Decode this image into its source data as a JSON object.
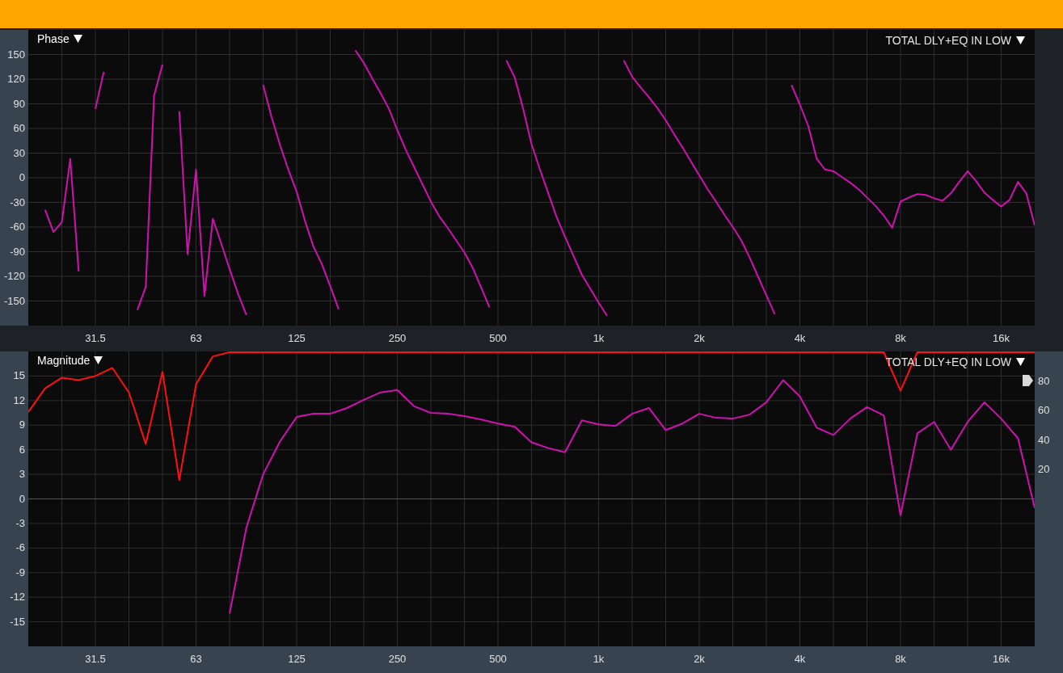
{
  "phase_panel": {
    "title": "Phase",
    "trace_label": "TOTAL DLY+EQ IN LOW",
    "chart_data": {
      "type": "line",
      "grid": true,
      "ylim": [
        -180,
        180
      ],
      "yticks": [
        150,
        120,
        90,
        60,
        30,
        0,
        -30,
        -60,
        -90,
        -120,
        -150
      ],
      "categories": [
        null,
        null,
        null,
        null,
        null,
        null,
        null,
        null,
        "31.5",
        null,
        null,
        null,
        null,
        null,
        null,
        null,
        null,
        null,
        null,
        null,
        "63",
        null,
        null,
        null,
        null,
        null,
        null,
        null,
        null,
        null,
        null,
        null,
        "125",
        null,
        null,
        null,
        null,
        null,
        null,
        null,
        null,
        null,
        null,
        null,
        "250",
        null,
        null,
        null,
        null,
        null,
        null,
        null,
        null,
        null,
        null,
        null,
        "500",
        null,
        null,
        null,
        null,
        null,
        null,
        null,
        null,
        null,
        null,
        null,
        "1k",
        null,
        null,
        null,
        null,
        null,
        null,
        null,
        null,
        null,
        null,
        null,
        "2k",
        null,
        null,
        null,
        null,
        null,
        null,
        null,
        null,
        null,
        null,
        null,
        "4k",
        null,
        null,
        null,
        null,
        null,
        null,
        null,
        null,
        null,
        null,
        null,
        "8k",
        null,
        null,
        null,
        null,
        null,
        null,
        null,
        null,
        null,
        null,
        null,
        "16k",
        null,
        null,
        null,
        null
      ],
      "series": [
        {
          "color": "#d010b0",
          "values": [
            null,
            null,
            -39,
            -66,
            -54,
            23,
            -114,
            null,
            84,
            129,
            null,
            null,
            null,
            -161,
            -133,
            100,
            138,
            null,
            81,
            -93,
            10,
            -144,
            -50,
            -80,
            -111,
            -141,
            -167,
            null,
            113,
            74,
            40,
            10,
            -17,
            -53,
            -84,
            -105,
            -132,
            -160,
            null,
            155,
            140,
            121,
            103,
            84,
            58,
            34,
            13,
            -8,
            -29,
            -47,
            -61,
            -76,
            -91,
            -110,
            -134,
            -158,
            null,
            143,
            122,
            84,
            41,
            10,
            -19,
            -48,
            -72,
            -95,
            -118,
            -135,
            -152,
            -168,
            null,
            143,
            123,
            110,
            98,
            85,
            70,
            53,
            37,
            20,
            3,
            -14,
            -29,
            -45,
            -60,
            -76,
            -97,
            -120,
            -143,
            -166,
            null,
            113,
            89,
            63,
            23,
            10,
            8,
            1,
            -6,
            -14,
            -24,
            -34,
            -46,
            -61,
            -29,
            -24,
            -20,
            -21,
            -25,
            -28,
            -19,
            -5,
            8,
            -4,
            -18,
            -27,
            -35,
            -27,
            -5,
            -19,
            -58
          ]
        }
      ]
    }
  },
  "magnitude_panel": {
    "title": "Magnitude",
    "trace_label": "TOTAL DLY+EQ IN LOW",
    "chart_data": {
      "type": "line",
      "grid": true,
      "ylim": [
        -18,
        18
      ],
      "yticks": [
        15,
        12,
        9,
        6,
        3,
        0,
        -3,
        -6,
        -9,
        -12,
        -15
      ],
      "y2lim": [
        -100,
        100
      ],
      "y2ticks": [
        80,
        60,
        40,
        20
      ],
      "categories": [
        null,
        null,
        null,
        null,
        "31.5",
        null,
        null,
        null,
        null,
        null,
        "63",
        null,
        null,
        null,
        null,
        null,
        "125",
        null,
        null,
        null,
        null,
        null,
        "250",
        null,
        null,
        null,
        null,
        null,
        "500",
        null,
        null,
        null,
        null,
        null,
        "1k",
        null,
        null,
        null,
        null,
        null,
        "2k",
        null,
        null,
        null,
        null,
        null,
        "4k",
        null,
        null,
        null,
        null,
        null,
        "8k",
        null,
        null,
        null,
        null,
        null,
        "16k",
        null,
        null
      ],
      "series": [
        {
          "color": "#d010b0",
          "values": [
            null,
            null,
            null,
            null,
            null,
            null,
            null,
            null,
            null,
            null,
            null,
            null,
            -14,
            -3.5,
            3,
            7,
            10,
            10.4,
            10.4,
            11.1,
            12.1,
            13,
            13.3,
            11.3,
            10.5,
            10.4,
            10.1,
            9.7,
            9.2,
            8.8,
            6.9,
            6.2,
            5.7,
            9.6,
            9.1,
            8.9,
            10.4,
            11.1,
            8.4,
            9.2,
            10.4,
            9.9,
            9.8,
            10.3,
            11.8,
            14.5,
            12.5,
            8.7,
            7.8,
            9.8,
            11.2,
            10.2,
            -2,
            8,
            9.4,
            6,
            9.4,
            11.8,
            9.8,
            7.4,
            -1.1
          ]
        },
        {
          "color": "#ff1010",
          "values": [
            10.6,
            13.5,
            14.8,
            14.5,
            15,
            16,
            13,
            6.7,
            15.5,
            2.3,
            14,
            17.4,
            17.9,
            17.9,
            17.9,
            17.9,
            17.9,
            17.9,
            17.9,
            17.9,
            17.9,
            17.9,
            17.9,
            17.9,
            17.9,
            17.9,
            17.9,
            17.9,
            17.9,
            17.9,
            17.9,
            17.9,
            17.9,
            17.9,
            17.9,
            17.9,
            17.9,
            17.9,
            17.9,
            17.9,
            17.9,
            17.9,
            17.9,
            17.9,
            17.9,
            17.9,
            17.9,
            17.9,
            17.9,
            17.9,
            17.9,
            17.9,
            13.2,
            17.9,
            17.9,
            17.9,
            17.9,
            17.9,
            17.9,
            17.9,
            17.9
          ]
        }
      ]
    }
  }
}
